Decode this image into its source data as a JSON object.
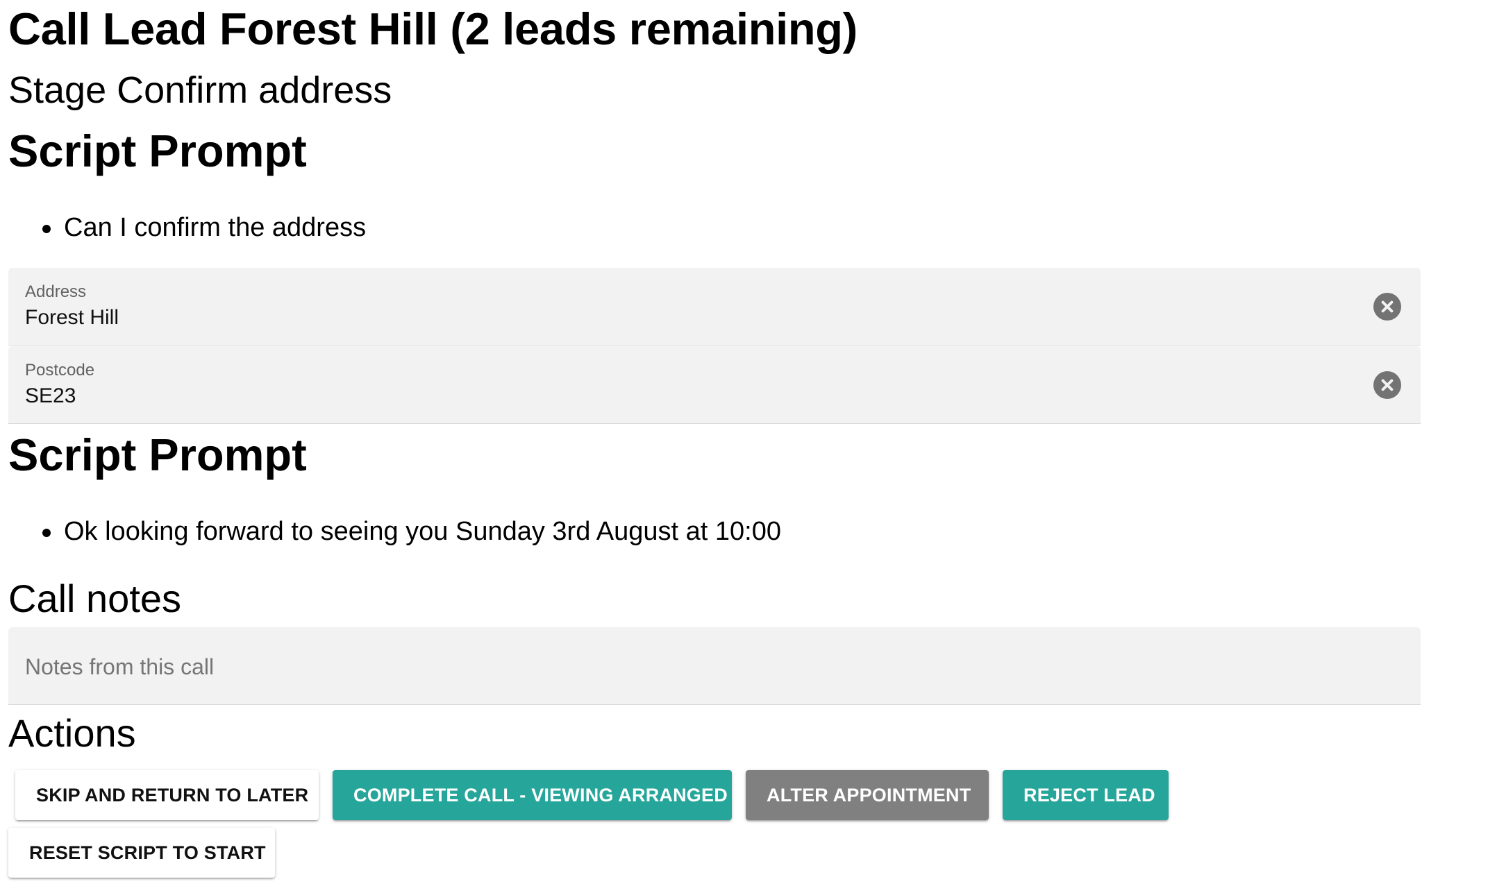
{
  "header": {
    "title": "Call Lead Forest Hill (2 leads remaining)",
    "stage_label": "Stage",
    "stage_value": "Confirm address"
  },
  "script_prompt_1": {
    "heading": "Script Prompt",
    "items": [
      "Can I confirm the address"
    ]
  },
  "address_form": {
    "address": {
      "label": "Address",
      "value": "Forest Hill"
    },
    "postcode": {
      "label": "Postcode",
      "value": "SE23"
    }
  },
  "script_prompt_2": {
    "heading": "Script Prompt",
    "items": [
      "Ok looking forward to seeing you Sunday 3rd August at 10:00"
    ]
  },
  "call_notes": {
    "heading": "Call notes",
    "placeholder": "Notes from this call",
    "value": ""
  },
  "actions": {
    "heading": "Actions",
    "skip_label": "SKIP AND RETURN TO LATER",
    "complete_label": "COMPLETE CALL - VIEWING ARRANGED",
    "alter_label": "ALTER APPOINTMENT",
    "reject_label": "REJECT LEAD",
    "reset_label": "RESET SCRIPT TO START"
  },
  "colors": {
    "primary_teal": "#26a69a",
    "secondary_grey": "#808080",
    "field_background": "#f2f2f2"
  },
  "icons": {
    "clear": "close-circle-icon"
  }
}
